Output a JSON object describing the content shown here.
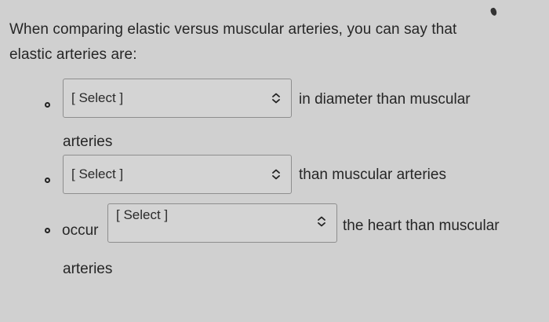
{
  "question": {
    "text": "When comparing elastic versus muscular arteries, you can say that elastic arteries are:"
  },
  "options": [
    {
      "select_value": "[ Select ]",
      "after_text": "in diameter than muscular",
      "continuation": "arteries"
    },
    {
      "select_value": "[ Select ]",
      "after_text": "than muscular arteries"
    },
    {
      "before_text": "occur",
      "select_value": "[ Select ]",
      "after_text": "the heart than muscular",
      "continuation": "arteries"
    }
  ],
  "icons": {
    "bullet": "circle-bullet-icon",
    "select_arrow": "chevron-up-down-icon",
    "corner_mark": "pen-mark-icon"
  }
}
